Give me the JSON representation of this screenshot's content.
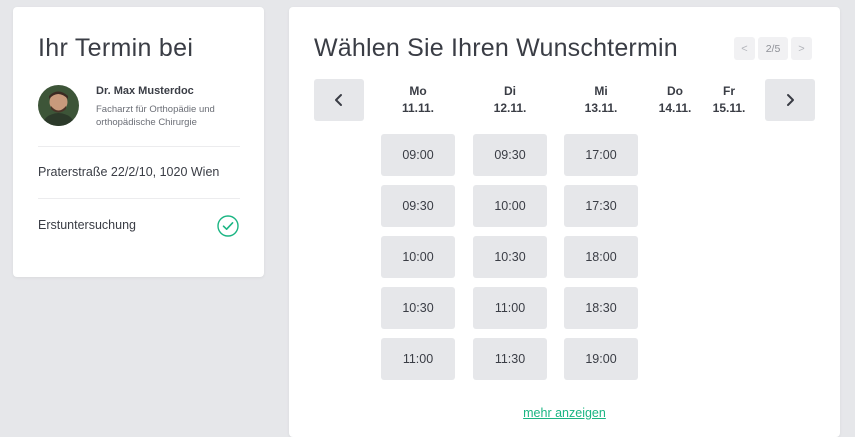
{
  "summary": {
    "title": "Ihr Termin bei",
    "doctor_name": "Dr. Max Musterdoc",
    "doctor_specialty": "Facharzt für Orthopädie und orthopädische Chirurgie",
    "address": "Praterstraße 22/2/10, 1020 Wien",
    "visit_type": "Erstuntersuchung"
  },
  "booking": {
    "title": "Wählen Sie Ihren Wunschtermin",
    "pager": {
      "prev": "<",
      "page": "2/5",
      "next": ">"
    },
    "days": [
      {
        "name": "Mo",
        "date": "11.11.",
        "slots": [
          "09:00",
          "09:30",
          "10:00",
          "10:30",
          "11:00"
        ]
      },
      {
        "name": "Di",
        "date": "12.11.",
        "slots": [
          "09:30",
          "10:00",
          "10:30",
          "11:00",
          "11:30"
        ]
      },
      {
        "name": "Mi",
        "date": "13.11.",
        "slots": [
          "17:00",
          "17:30",
          "18:00",
          "18:30",
          "19:00"
        ]
      },
      {
        "name": "Do",
        "date": "14.11.",
        "slots": []
      },
      {
        "name": "Fr",
        "date": "15.11.",
        "slots": []
      }
    ],
    "more_link": "mehr anzeigen"
  },
  "colors": {
    "accent": "#1bb583",
    "slot_bg": "#e6e7ea",
    "background": "#e6e7ea"
  },
  "icons": {
    "check": "check-circle-icon",
    "prev": "chevron-left-icon",
    "next": "chevron-right-icon"
  }
}
